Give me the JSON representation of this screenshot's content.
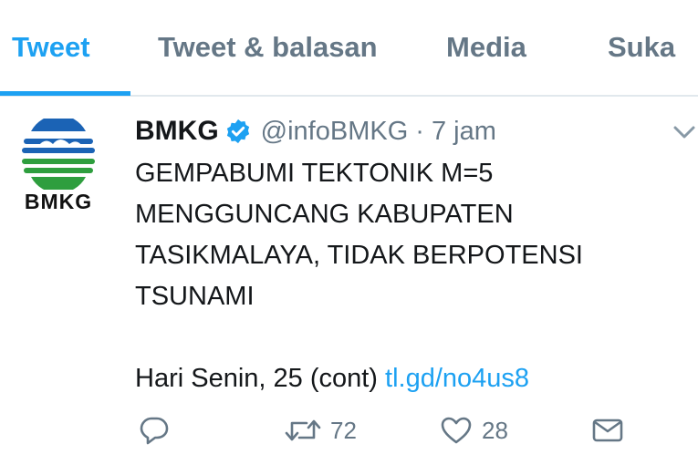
{
  "tabs": [
    {
      "label": "Tweet",
      "active": true
    },
    {
      "label": "Tweet & balasan",
      "active": false
    },
    {
      "label": "Media",
      "active": false
    },
    {
      "label": "Suka",
      "active": false
    }
  ],
  "tweet": {
    "avatar_label": "BMKG",
    "display_name": "BMKG",
    "handle": "@infoBMKG",
    "separator": "·",
    "time": "7 jam",
    "text_lines": [
      "GEMPABUMI TEKTONIK M=5",
      "MENGGUNCANG KABUPATEN",
      "TASIKMALAYA, TIDAK BERPOTENSI",
      "TSUNAMI"
    ],
    "second_paragraph": "Hari Senin, 25 (cont)",
    "link": "tl.gd/no4us8",
    "retweet_count": "72",
    "like_count": "28"
  },
  "colors": {
    "accent": "#1da1f2",
    "secondary_text": "#657786",
    "primary_text": "#14171a"
  },
  "icons": [
    "verified-badge-icon",
    "chevron-down-icon",
    "reply-icon",
    "retweet-icon",
    "like-icon",
    "direct-message-icon"
  ]
}
